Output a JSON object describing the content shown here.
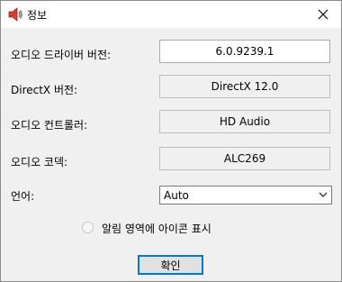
{
  "window": {
    "title": "정보",
    "title_icon": "speaker-icon",
    "close_icon": "close-icon"
  },
  "rows": [
    {
      "label": "오디오 드라이버 버전:",
      "value": "6.0.9239.1"
    },
    {
      "label": "DirectX 버전:",
      "value": "DirectX 12.0"
    },
    {
      "label": "오디오 컨트롤러:",
      "value": "HD Audio"
    },
    {
      "label": "오디오 코덱:",
      "value": "ALC269"
    }
  ],
  "language": {
    "label": "언어:",
    "selected": "Auto"
  },
  "tray_option": {
    "label": "알림 영역에 아이콘 표시",
    "checked": false
  },
  "ok_button": "확인",
  "colors": {
    "accent": "#0078d7",
    "speaker_red": "#d83b2f"
  }
}
